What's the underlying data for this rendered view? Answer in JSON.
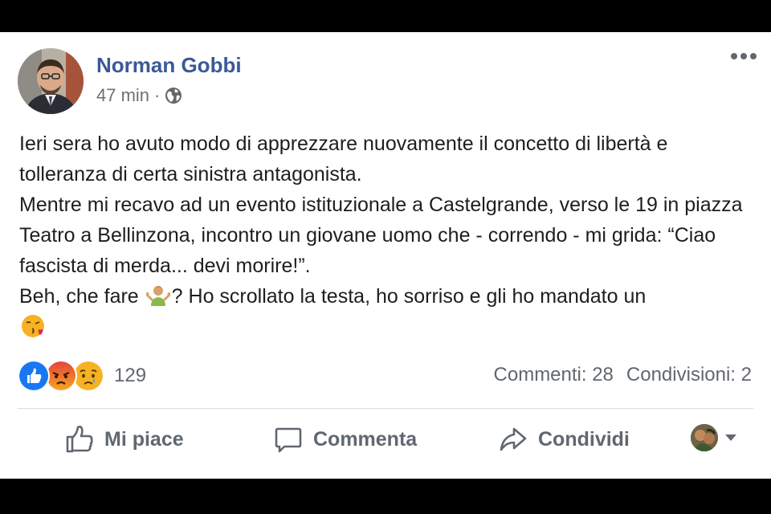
{
  "post": {
    "author": "Norman Gobbi",
    "time": "47 min",
    "separator": "·",
    "audience_icon": "globe-icon",
    "paragraphs": [
      "Ieri sera ho avuto modo di apprezzare nuovamente il concetto di libertà e tolleranza di certa sinistra antagonista.",
      "Mentre mi recavo ad un evento istituzionale a Castelgrande, verso le 19 in piazza Teatro a Bellinzona, incontro un giovane uomo che - correndo - mi grida: “Ciao fascista di merda... devi morire!”."
    ],
    "last_line_before_emoji": "Beh, che fare",
    "last_line_after_emoji": "? Ho scrollato la testa, ho sorriso e gli ho mandato un",
    "inline_emojis": [
      "shrug-emoji",
      "kiss-emoji"
    ]
  },
  "reactions": {
    "types": [
      "like",
      "angry",
      "sad"
    ],
    "count": "129"
  },
  "counts": {
    "comments": "Commenti: 28",
    "shares": "Condivisioni: 2"
  },
  "actions": {
    "like": "Mi piace",
    "comment": "Commenta",
    "share": "Condividi"
  },
  "colors": {
    "author": "#3b5998",
    "like_blue": "#1877f2",
    "angry_red": "#e9710f",
    "sad_yellow": "#f7b125",
    "text": "#1c1e21",
    "muted": "#616770"
  }
}
